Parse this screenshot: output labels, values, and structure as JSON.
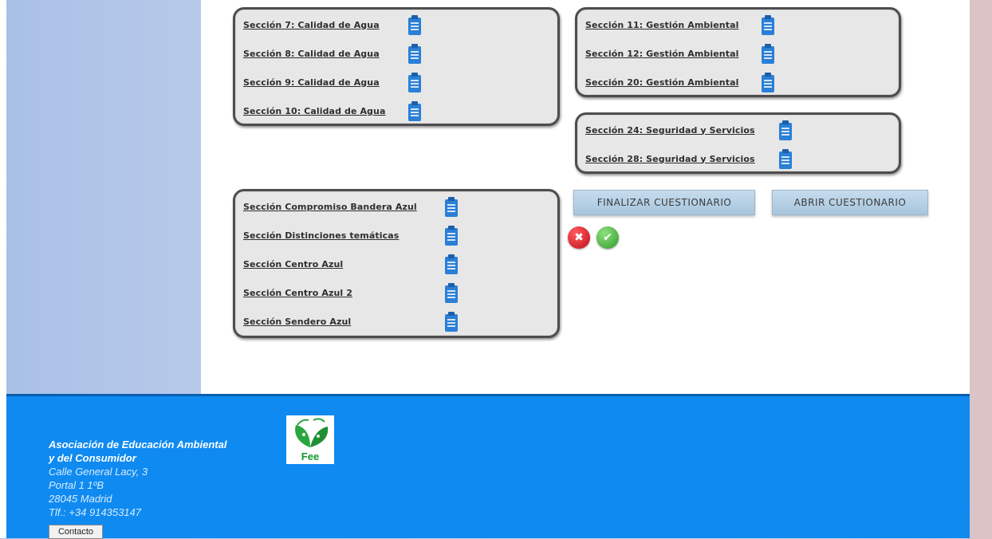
{
  "panels": {
    "agua": [
      {
        "label": "Sección 7: Calidad de Agua"
      },
      {
        "label": "Sección 8: Calidad de Agua"
      },
      {
        "label": "Sección 9: Calidad de Agua"
      },
      {
        "label": "Sección 10: Calidad de Agua"
      }
    ],
    "gestion": [
      {
        "label": "Sección 11: Gestión Ambiental"
      },
      {
        "label": "Sección 12: Gestión Ambiental"
      },
      {
        "label": "Sección 20: Gestión Ambiental"
      }
    ],
    "seguridad": [
      {
        "label": "Sección 24: Seguridad y Servicios"
      },
      {
        "label": "Sección 28: Seguridad y Servicios"
      }
    ],
    "otros": [
      {
        "label": "Sección Compromiso Bandera Azul"
      },
      {
        "label": "Sección Distinciones temáticas"
      },
      {
        "label": "Sección Centro Azul"
      },
      {
        "label": "Sección Centro Azul 2"
      },
      {
        "label": "Sección Sendero Azul"
      }
    ]
  },
  "actions": {
    "finalizar": "FINALIZAR CUESTIONARIO",
    "abrir": "ABRIR CUESTIONARIO"
  },
  "status_icons": [
    "close-icon",
    "check-icon"
  ],
  "footer": {
    "org_line1": "Asociación de Educación Ambiental",
    "org_line2": "y del Consumidor",
    "address1": "Calle General Lacy, 3",
    "address2": "Portal 1 1ºB",
    "address3": "28045 Madrid",
    "phone": "Tlf.: +34 914353147",
    "contact_label": "Contacto",
    "logo_text": "Fee"
  },
  "colors": {
    "footer_bg": "#0f8af1",
    "panel_bg": "#e7e7e7",
    "clipboard": "#2a7fd6",
    "cancel": "#d0222a",
    "ok": "#39a935"
  }
}
